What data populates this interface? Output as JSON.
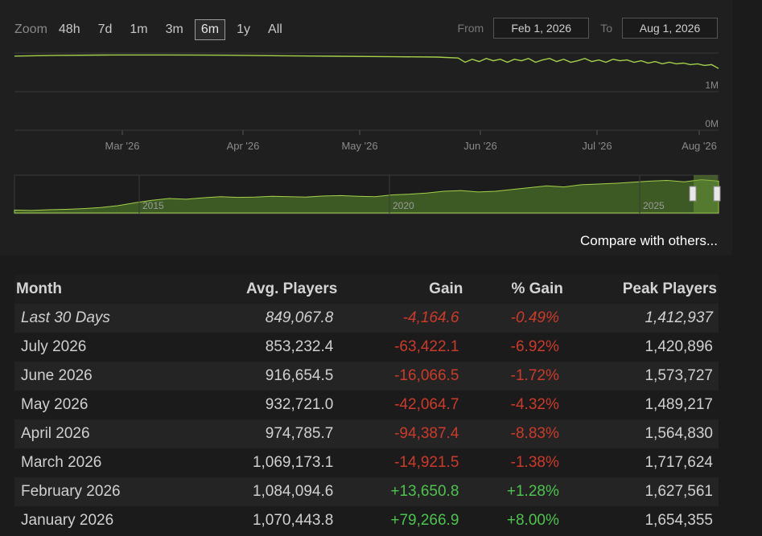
{
  "zoom": {
    "label": "Zoom",
    "buttons": [
      "48h",
      "7d",
      "1m",
      "3m",
      "6m",
      "1y",
      "All"
    ],
    "active": "6m"
  },
  "range": {
    "from_label": "From",
    "from_value": "Feb 1, 2026",
    "to_label": "To",
    "to_value": "Aug 1, 2026"
  },
  "compare_link": "Compare with others...",
  "colors": {
    "line": "#a4d04a",
    "navigator_fill": "#3d5a25",
    "negative": "#cc3b2a",
    "positive": "#4ec24e"
  },
  "chart_data": [
    {
      "type": "line",
      "series": [
        {
          "values": [
            [
              0,
              0.96
            ],
            [
              6,
              0.97
            ],
            [
              14,
              0.975
            ],
            [
              22,
              0.975
            ],
            [
              30,
              0.972
            ],
            [
              38,
              0.965
            ],
            [
              46,
              0.958
            ],
            [
              54,
              0.952
            ],
            [
              60,
              0.948
            ],
            [
              63,
              0.935
            ],
            [
              64,
              0.88
            ],
            [
              65,
              0.92
            ],
            [
              66,
              0.89
            ],
            [
              67,
              0.93
            ],
            [
              68,
              0.9
            ],
            [
              69,
              0.92
            ],
            [
              70,
              0.88
            ],
            [
              71,
              0.92
            ],
            [
              72,
              0.9
            ],
            [
              73,
              0.93
            ],
            [
              74,
              0.88
            ],
            [
              75,
              0.91
            ],
            [
              76,
              0.93
            ],
            [
              77,
              0.89
            ],
            [
              78,
              0.92
            ],
            [
              79,
              0.88
            ],
            [
              80,
              0.9
            ],
            [
              81,
              0.93
            ],
            [
              82,
              0.89
            ],
            [
              83,
              0.91
            ],
            [
              84,
              0.88
            ],
            [
              85,
              0.92
            ],
            [
              86,
              0.9
            ],
            [
              87,
              0.91
            ],
            [
              88,
              0.88
            ],
            [
              89,
              0.9
            ],
            [
              90,
              0.87
            ],
            [
              91,
              0.89
            ],
            [
              92,
              0.86
            ],
            [
              93,
              0.88
            ],
            [
              94,
              0.86
            ],
            [
              95,
              0.87
            ],
            [
              96,
              0.85
            ],
            [
              97,
              0.86
            ],
            [
              98,
              0.84
            ],
            [
              99,
              0.85
            ],
            [
              100,
              0.8
            ]
          ]
        }
      ],
      "y_axis_labels": [
        "1M",
        "0M"
      ],
      "x_axis_labels": [
        "Mar '26",
        "Apr '26",
        "May '26",
        "Jun '26",
        "Jul '26",
        "Aug '26"
      ],
      "grid": true
    },
    {
      "type": "area",
      "series": [
        {
          "values": [
            0.08,
            0.07,
            0.09,
            0.1,
            0.12,
            0.15,
            0.2,
            0.28,
            0.35,
            0.4,
            0.38,
            0.42,
            0.45,
            0.43,
            0.44,
            0.46,
            0.45,
            0.44,
            0.47,
            0.48,
            0.46,
            0.45,
            0.5,
            0.52,
            0.55,
            0.6,
            0.62,
            0.58,
            0.6,
            0.65,
            0.7,
            0.75,
            0.72,
            0.78,
            0.8,
            0.82,
            0.85,
            0.88,
            0.9,
            0.86,
            0.92,
            0.88
          ]
        }
      ],
      "x_axis_labels": [
        "2015",
        "2020",
        "2025"
      ]
    }
  ],
  "table": {
    "headers": [
      "Month",
      "Avg. Players",
      "Gain",
      "% Gain",
      "Peak Players"
    ],
    "rows": [
      {
        "month": "Last 30 Days",
        "avg": "849,067.8",
        "gain": "-4,164.6",
        "pct": "-0.49%",
        "peak": "1,412,937",
        "sign": "neg",
        "italic": true
      },
      {
        "month": "July 2026",
        "avg": "853,232.4",
        "gain": "-63,422.1",
        "pct": "-6.92%",
        "peak": "1,420,896",
        "sign": "neg",
        "italic": false
      },
      {
        "month": "June 2026",
        "avg": "916,654.5",
        "gain": "-16,066.5",
        "pct": "-1.72%",
        "peak": "1,573,727",
        "sign": "neg",
        "italic": false
      },
      {
        "month": "May 2026",
        "avg": "932,721.0",
        "gain": "-42,064.7",
        "pct": "-4.32%",
        "peak": "1,489,217",
        "sign": "neg",
        "italic": false
      },
      {
        "month": "April 2026",
        "avg": "974,785.7",
        "gain": "-94,387.4",
        "pct": "-8.83%",
        "peak": "1,564,830",
        "sign": "neg",
        "italic": false
      },
      {
        "month": "March 2026",
        "avg": "1,069,173.1",
        "gain": "-14,921.5",
        "pct": "-1.38%",
        "peak": "1,717,624",
        "sign": "neg",
        "italic": false
      },
      {
        "month": "February 2026",
        "avg": "1,084,094.6",
        "gain": "+13,650.8",
        "pct": "+1.28%",
        "peak": "1,627,561",
        "sign": "pos",
        "italic": false
      },
      {
        "month": "January 2026",
        "avg": "1,070,443.8",
        "gain": "+79,266.9",
        "pct": "+8.00%",
        "peak": "1,654,355",
        "sign": "pos",
        "italic": false
      }
    ]
  }
}
